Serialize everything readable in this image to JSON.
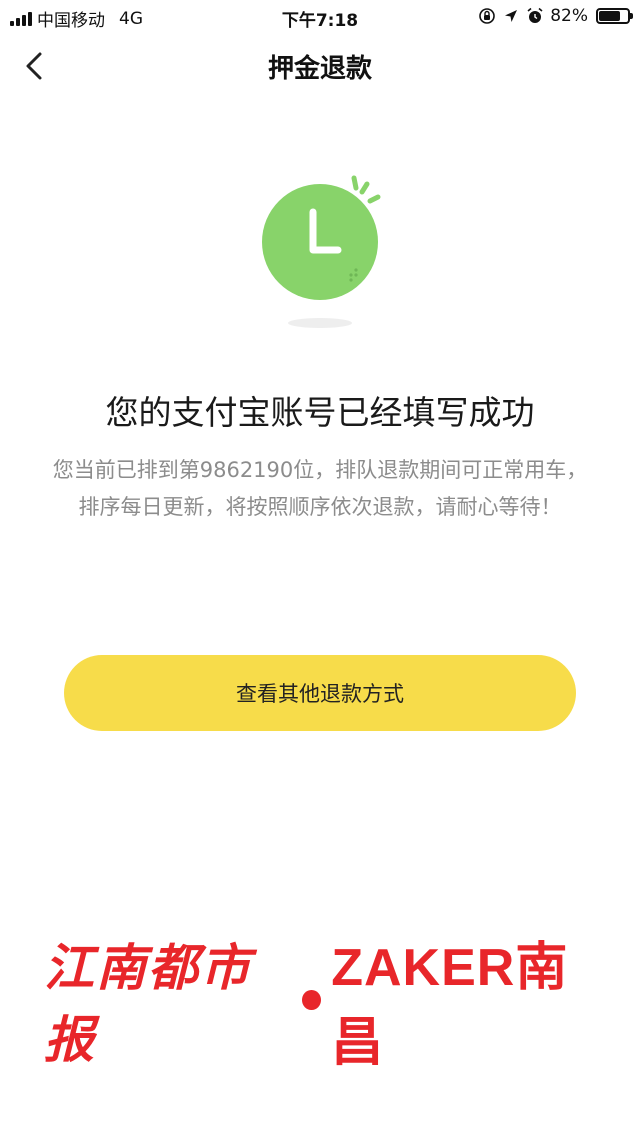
{
  "status_bar": {
    "carrier": "中国移动",
    "network": "4G",
    "time": "下午7:18",
    "battery": "82%",
    "battery_level": 0.82,
    "icons": [
      "orientation-lock-icon",
      "location-icon",
      "alarm-icon"
    ]
  },
  "nav": {
    "title": "押金退款",
    "back_icon": "chevron-left-icon"
  },
  "illustration": {
    "icon": "clock-icon",
    "color": "#88d36a"
  },
  "success": {
    "title": "您的支付宝账号已经填写成功",
    "description": "您当前已排到第9862190位，排队退款期间可正常用车，排序每日更新，将按照顺序依次退款，请耐心等待！"
  },
  "actions": {
    "other_refund_label": "查看其他退款方式",
    "button_color": "#f7dc4a"
  },
  "watermark": {
    "newspaper": "江南都市报",
    "brand": "ZAKER南昌",
    "color": "#e8262a"
  }
}
